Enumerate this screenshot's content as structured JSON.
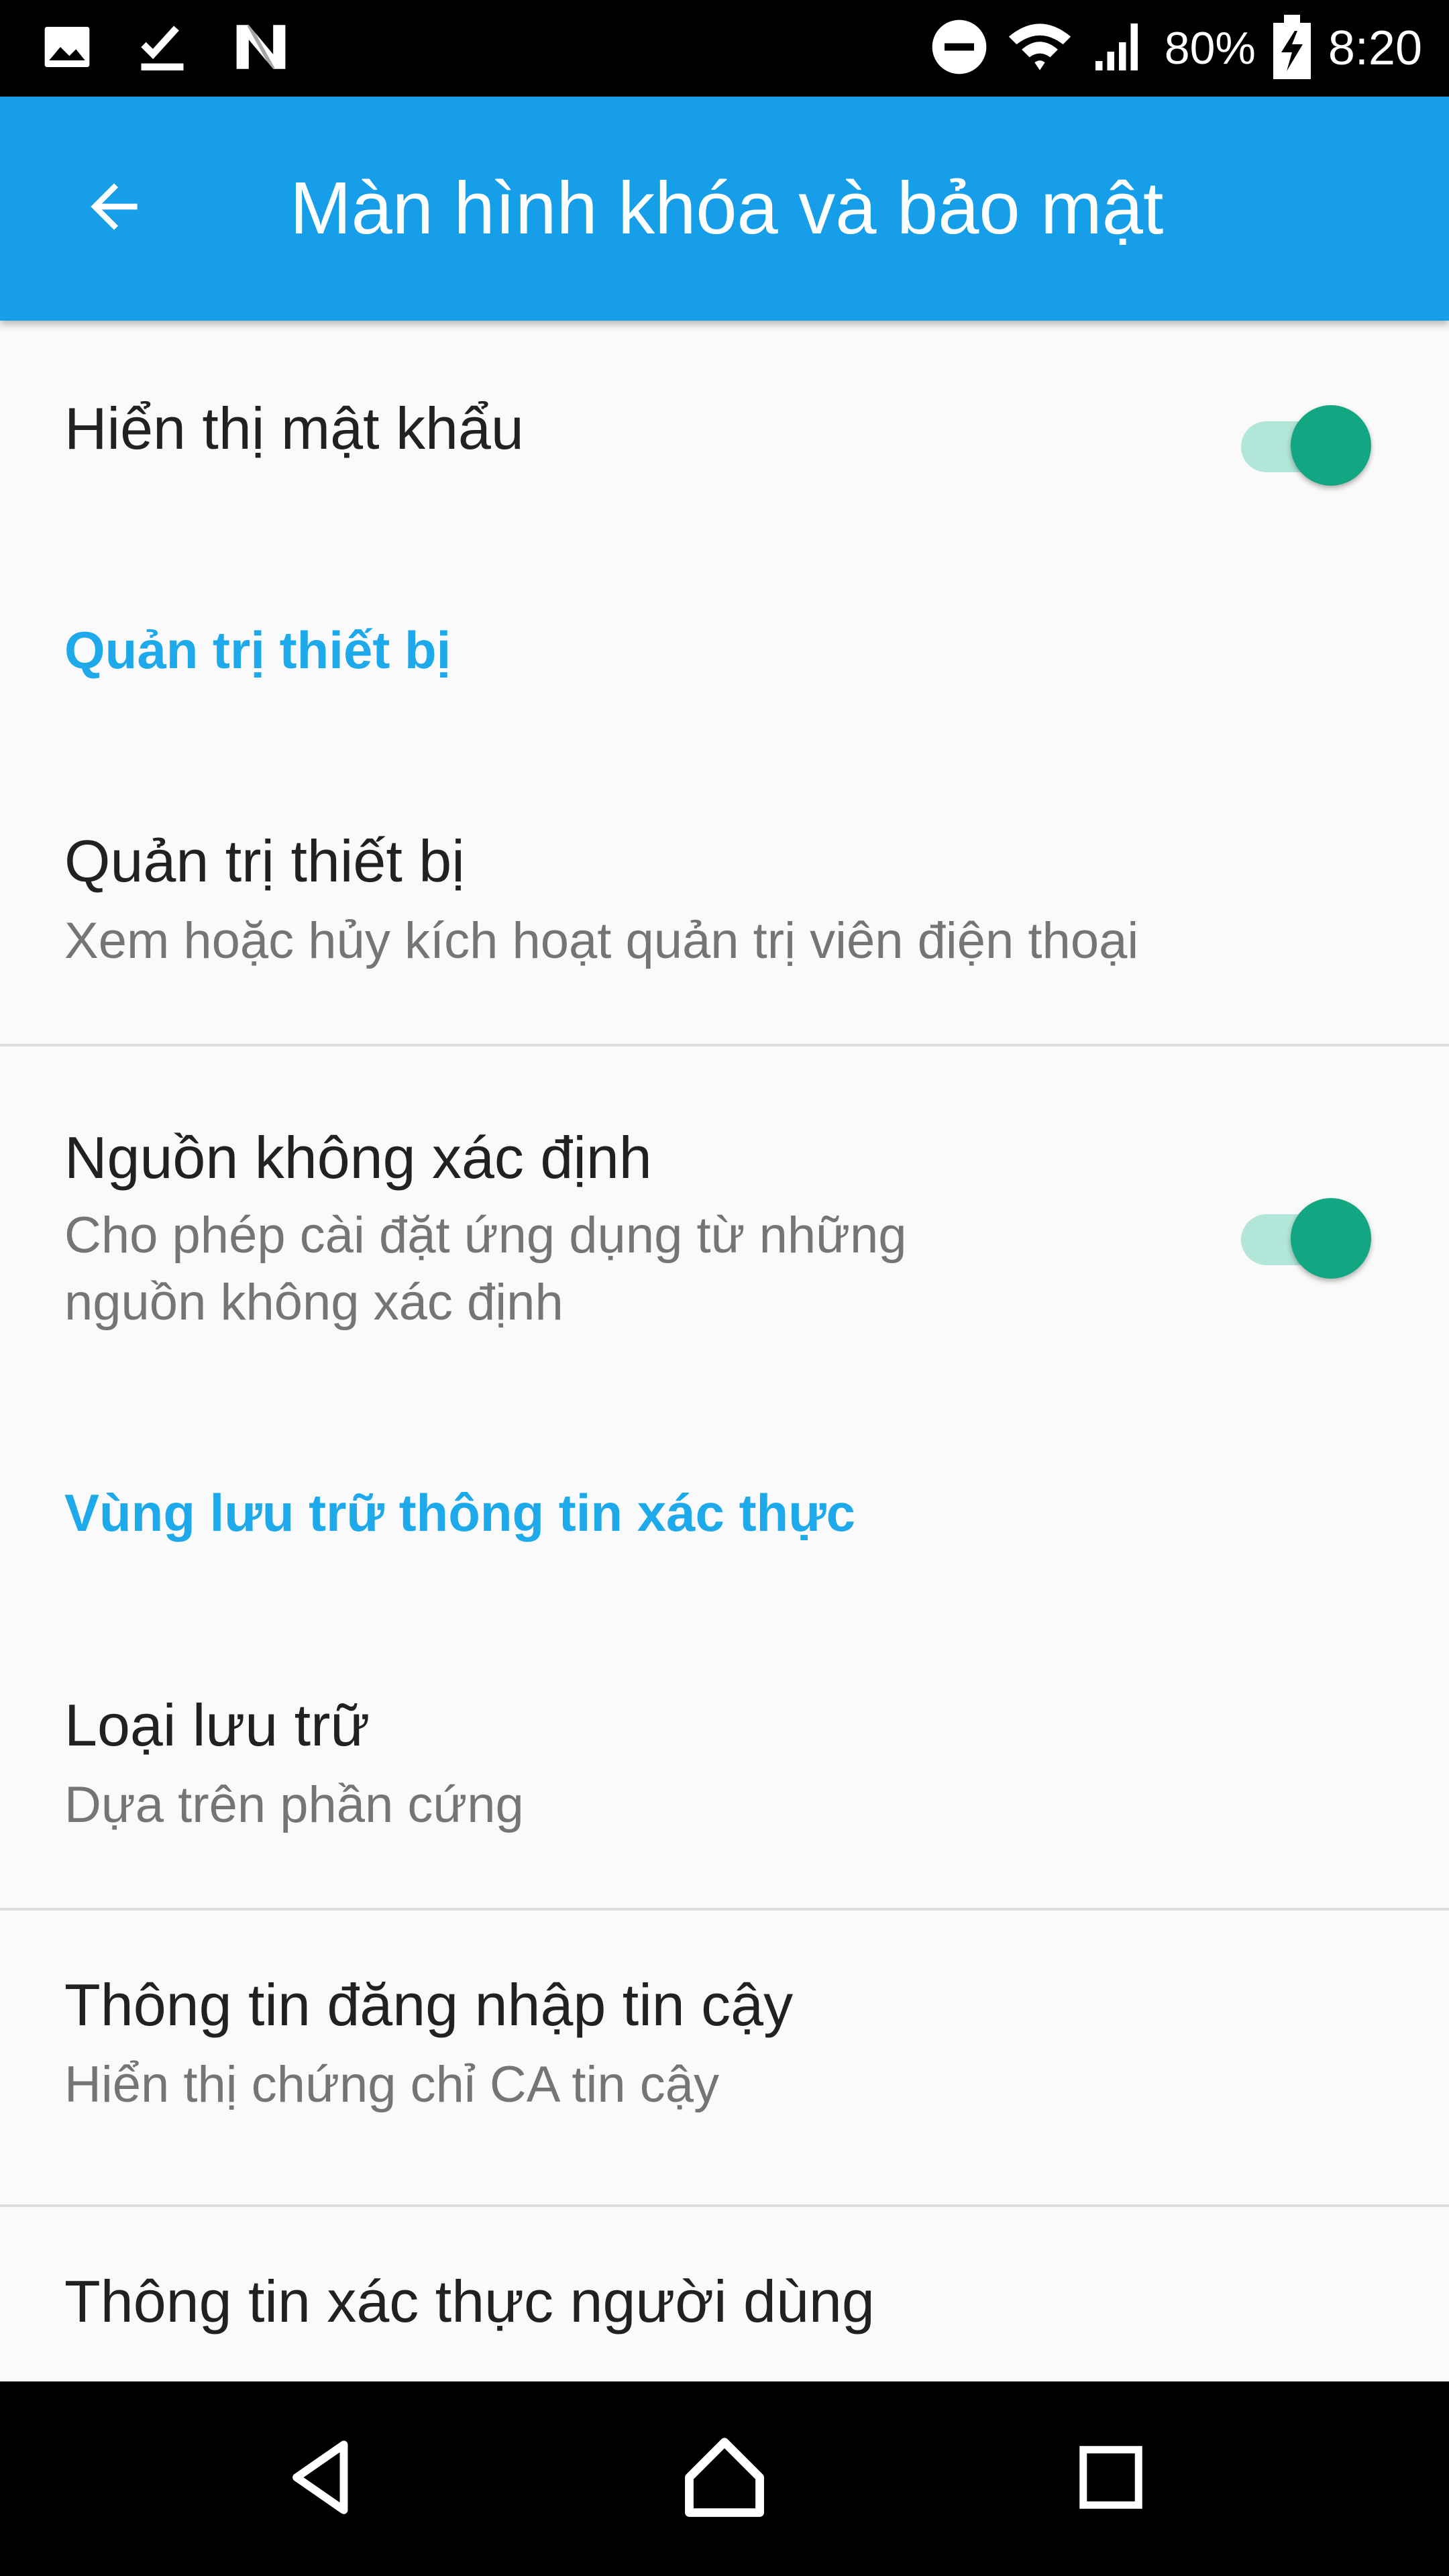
{
  "status_bar": {
    "battery_percent": "80%",
    "time": "8:20",
    "icons_left": [
      "image-icon",
      "download-done-icon",
      "n-icon"
    ],
    "icons_right": [
      "do-not-disturb-icon",
      "wifi-icon",
      "cellular-signal-icon",
      "battery-charging-icon"
    ]
  },
  "app_bar": {
    "title": "Màn hình khóa và bảo mật",
    "back_icon": "arrow-back-icon",
    "background": "#169ee9"
  },
  "settings": {
    "show_password": {
      "title": "Hiển thị mật khẩu",
      "enabled": true
    },
    "device_admin_category": "Quản trị thiết bị",
    "device_admin": {
      "title": "Quản trị thiết bị",
      "summary": "Xem hoặc hủy kích hoạt quản trị viên điện thoại"
    },
    "unknown_sources": {
      "title": "Nguồn không xác định",
      "summary_line1": "Cho phép cài đặt ứng dụng từ những",
      "summary_line2": "nguồn không xác định",
      "enabled": true
    },
    "credential_storage_category": "Vùng lưu trữ thông tin xác thực",
    "storage_type": {
      "title": "Loại lưu trữ",
      "summary": "Dựa trên phần cứng"
    },
    "trusted_credentials": {
      "title": "Thông tin đăng nhập tin cậy",
      "summary": "Hiển thị chứng chỉ CA tin cậy"
    },
    "user_credentials": {
      "title": "Thông tin xác thực người dùng"
    }
  },
  "colors": {
    "accent": "#1ea9ea",
    "switch_on": "#12a782",
    "switch_track_on": "#b2e6d9"
  },
  "nav_bar": {
    "back_icon": "nav-back-icon",
    "home_icon": "nav-home-icon",
    "recents_icon": "nav-recents-icon"
  }
}
